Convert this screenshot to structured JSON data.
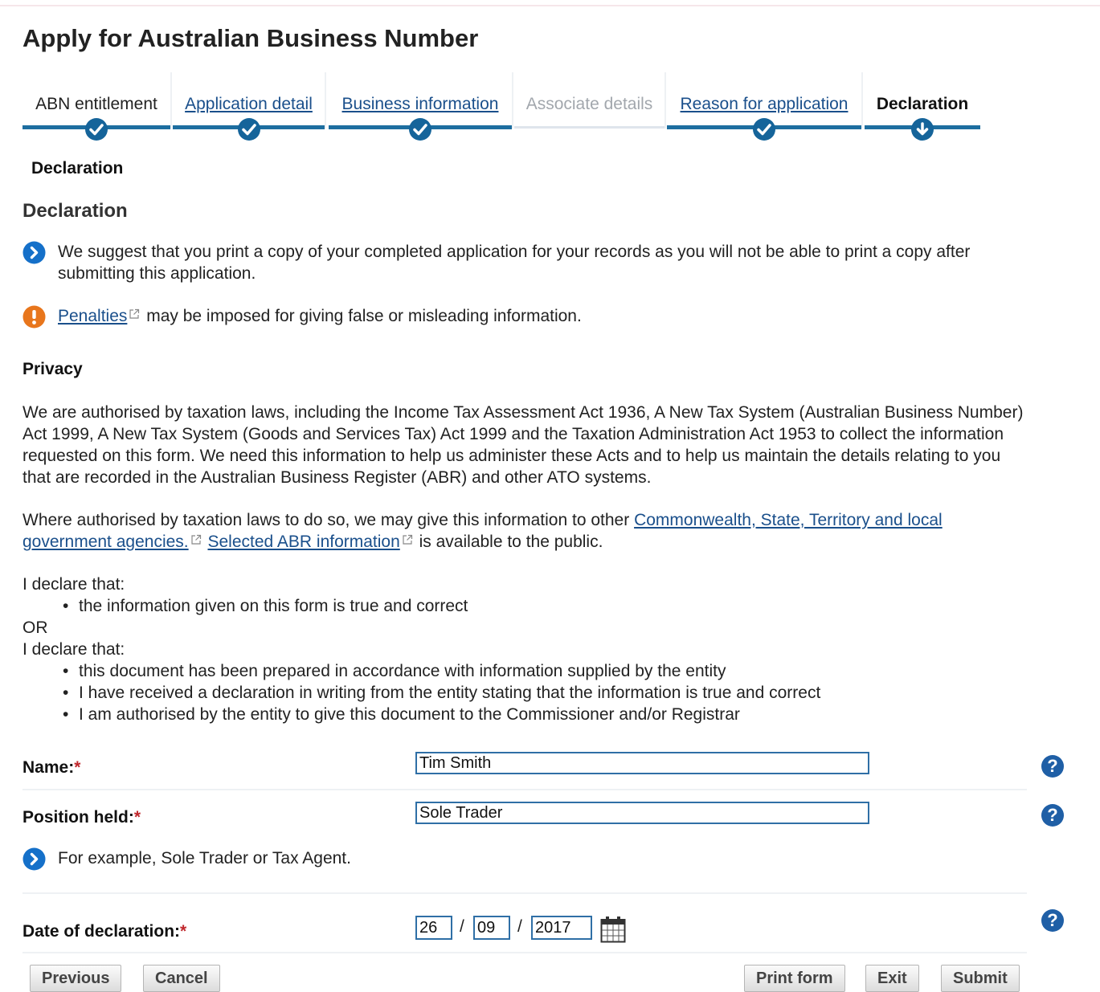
{
  "page": {
    "title": "Apply for Australian Business Number"
  },
  "steps": [
    {
      "label": "ABN entitlement",
      "state": "complete"
    },
    {
      "label": "Application detail",
      "state": "complete"
    },
    {
      "label": "Business information",
      "state": "complete"
    },
    {
      "label": "Associate details",
      "state": "disabled"
    },
    {
      "label": "Reason for application",
      "state": "complete"
    },
    {
      "label": "Declaration",
      "state": "current"
    }
  ],
  "section": {
    "subtitle": "Declaration",
    "heading": "Declaration"
  },
  "notes": {
    "print_note": "We suggest that you print a copy of your completed application for your records as you will not be able to print a copy after submitting this application.",
    "penalties_link": "Penalties",
    "penalties_text": "may be imposed for giving false or misleading information."
  },
  "privacy": {
    "heading": "Privacy",
    "para1": "We are authorised by taxation laws, including the Income Tax Assessment Act 1936, A New Tax System (Australian Business Number) Act 1999, A New Tax System (Goods and Services Tax) Act 1999 and the Taxation Administration Act 1953 to collect the information requested on this form. We need this information to help us administer these Acts and to help us maintain the details relating to you that are recorded in the Australian Business Register (ABR) and other ATO systems.",
    "para2_prefix": "Where authorised by taxation laws to do so, we may give this information to other",
    "para2_link1": "Commonwealth, State, Territory and local government agencies.",
    "para2_link2": "Selected ABR information",
    "para2_suffix": "is available to the public."
  },
  "declaration": {
    "intro1": "I declare that:",
    "bullets1": [
      "the information given on this form is true and correct"
    ],
    "or": "OR",
    "intro2": "I declare that:",
    "bullets2": [
      "this document has been prepared in accordance with information supplied by the entity",
      "I have received a declaration in writing from the entity stating that the information is true and correct",
      "I am authorised by the entity to give this document to the Commissioner and/or Registrar"
    ]
  },
  "form": {
    "required_mark": "*",
    "name_label": "Name:",
    "name_value": "Tim Smith",
    "position_label": "Position held:",
    "position_value": "Sole Trader",
    "position_hint": "For example, Sole Trader or Tax Agent.",
    "date_label": "Date of declaration:",
    "date_day": "26",
    "date_month": "09",
    "date_year": "2017",
    "date_sep": "/",
    "help_glyph": "?"
  },
  "buttons": {
    "previous": "Previous",
    "cancel": "Cancel",
    "print": "Print form",
    "exit": "Exit",
    "submit": "Submit"
  },
  "icons": {
    "info": "chevron-right-circle-icon",
    "warning": "exclamation-circle-icon",
    "help": "question-circle-icon",
    "calendar": "calendar-icon",
    "external": "external-link-icon"
  },
  "colors": {
    "accent": "#1d6ea0",
    "link": "#1a4f8b",
    "warning": "#e8761c",
    "required": "#c0282d"
  }
}
